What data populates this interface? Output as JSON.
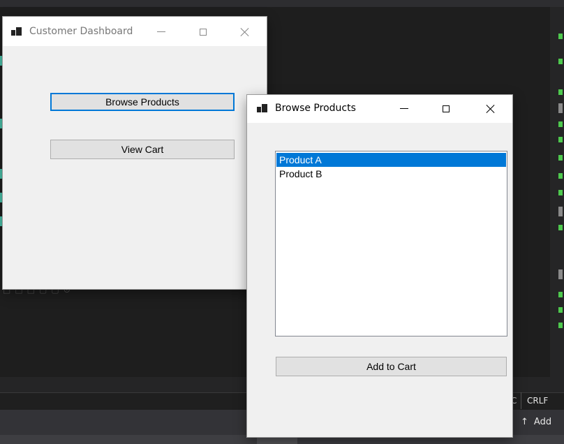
{
  "ide": {
    "status_encoding_char": "C",
    "line_ending": "CRLF",
    "status_action_label": "Add",
    "status_action_icon": "arrow-up-icon",
    "colors": {
      "background": "#1e1e1e",
      "panel": "#252526",
      "accent_green": "#4ec94e",
      "accent_teal": "#4ec9b0"
    }
  },
  "customer_dashboard": {
    "title": "Customer Dashboard",
    "icon": "window-app-icon",
    "controls": {
      "minimize": "minimize-icon",
      "maximize": "maximize-icon",
      "close": "close-icon"
    },
    "browse_products_label": "Browse Products",
    "view_cart_label": "View Cart"
  },
  "browse_products_window": {
    "title": "Browse Products",
    "icon": "window-app-icon",
    "controls": {
      "minimize": "minimize-icon",
      "maximize": "maximize-icon",
      "close": "close-icon"
    },
    "product_list": {
      "items": [
        "Product A",
        "Product B"
      ],
      "selected": "Product A"
    },
    "add_to_cart_label": "Add to Cart",
    "colors": {
      "selection": "#0078d7",
      "window_bg": "#f0f0f0",
      "button_bg": "#e1e1e1"
    }
  }
}
